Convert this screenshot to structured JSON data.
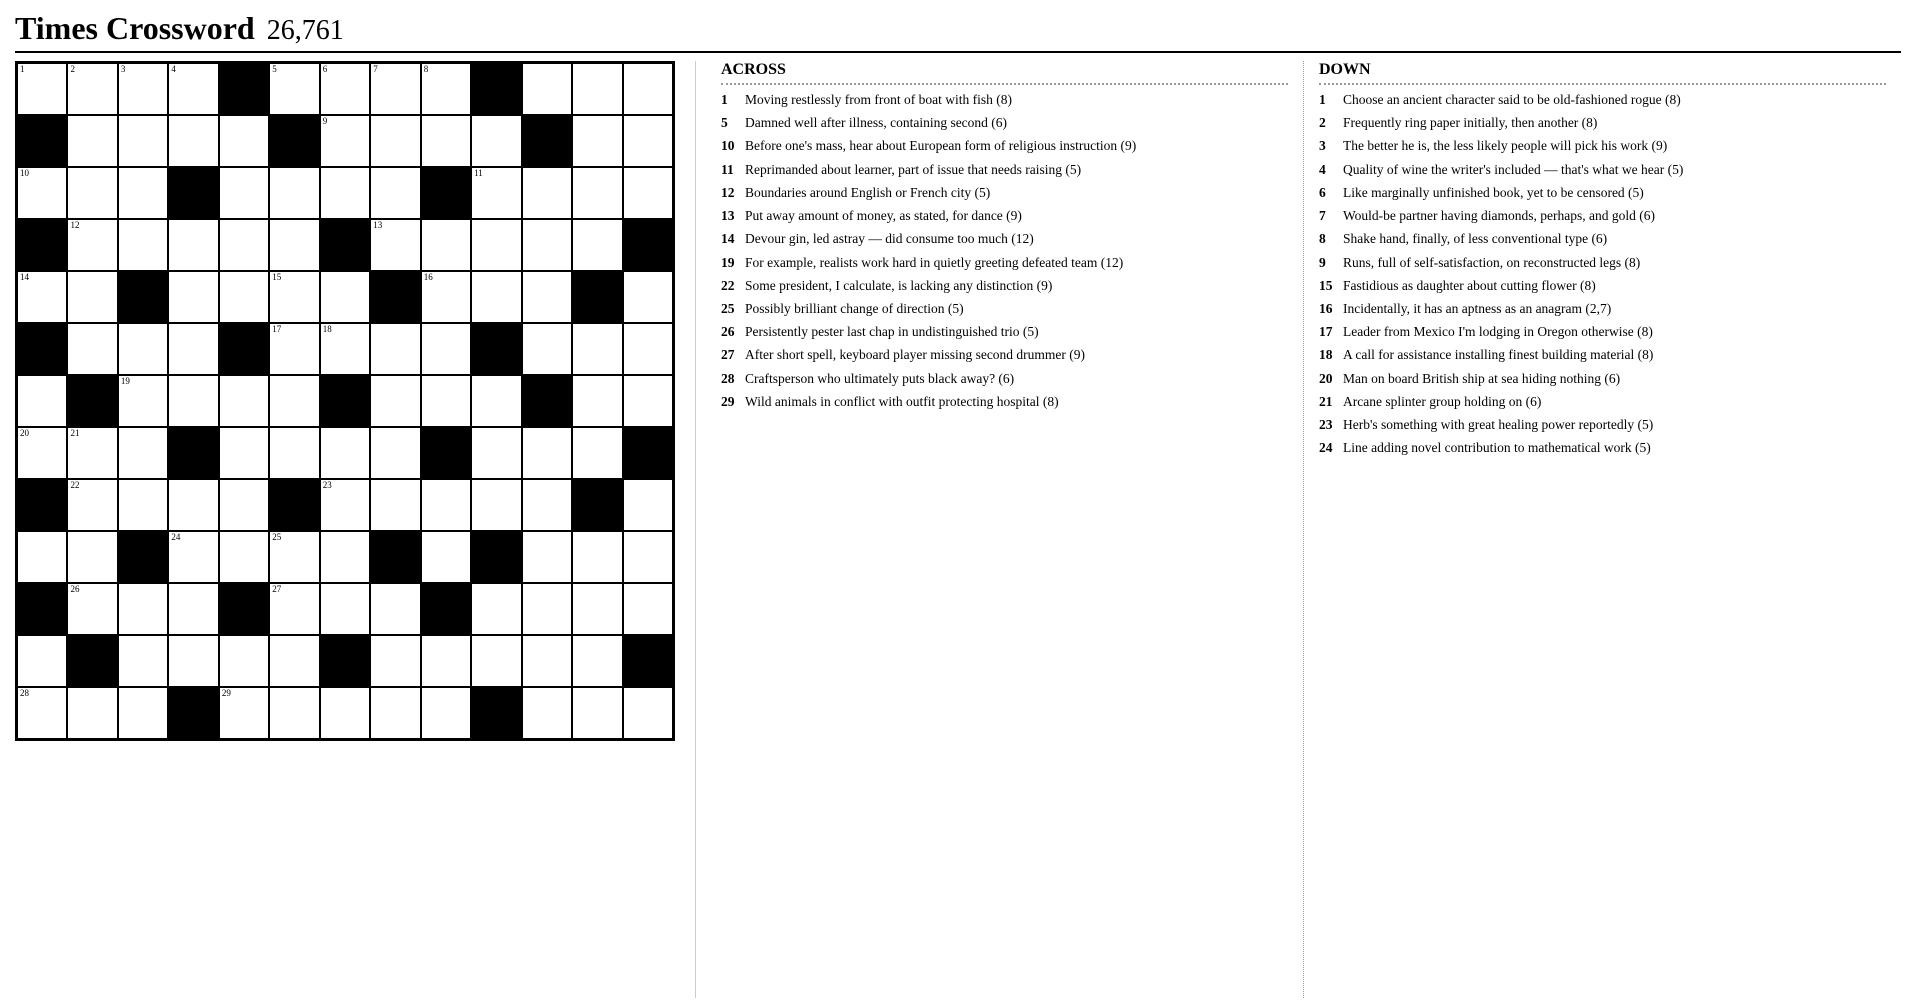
{
  "header": {
    "title": "Times Crossword",
    "number": "26,761"
  },
  "grid": {
    "size": 13,
    "black_cells": [
      [
        0,
        4
      ],
      [
        0,
        9
      ],
      [
        1,
        0
      ],
      [
        1,
        5
      ],
      [
        1,
        10
      ],
      [
        2,
        3
      ],
      [
        2,
        8
      ],
      [
        3,
        0
      ],
      [
        3,
        6
      ],
      [
        3,
        12
      ],
      [
        4,
        2
      ],
      [
        4,
        7
      ],
      [
        4,
        11
      ],
      [
        5,
        0
      ],
      [
        5,
        4
      ],
      [
        5,
        9
      ],
      [
        6,
        1
      ],
      [
        6,
        6
      ],
      [
        6,
        10
      ],
      [
        7,
        3
      ],
      [
        7,
        8
      ],
      [
        7,
        12
      ],
      [
        8,
        0
      ],
      [
        8,
        5
      ],
      [
        8,
        11
      ],
      [
        9,
        2
      ],
      [
        9,
        7
      ],
      [
        9,
        9
      ],
      [
        10,
        0
      ],
      [
        10,
        4
      ],
      [
        10,
        8
      ],
      [
        11,
        1
      ],
      [
        11,
        6
      ],
      [
        11,
        12
      ],
      [
        12,
        3
      ],
      [
        12,
        9
      ]
    ],
    "numbered_cells": [
      {
        "row": 0,
        "col": 0,
        "num": 1
      },
      {
        "row": 0,
        "col": 1,
        "num": 2
      },
      {
        "row": 0,
        "col": 2,
        "num": 3
      },
      {
        "row": 0,
        "col": 3,
        "num": 4
      },
      {
        "row": 0,
        "col": 5,
        "num": 5
      },
      {
        "row": 0,
        "col": 6,
        "num": 6
      },
      {
        "row": 0,
        "col": 7,
        "num": 7
      },
      {
        "row": 0,
        "col": 8,
        "num": 8
      },
      {
        "row": 1,
        "col": 6,
        "num": 9
      },
      {
        "row": 2,
        "col": 0,
        "num": 10
      },
      {
        "row": 2,
        "col": 9,
        "num": 11
      },
      {
        "row": 3,
        "col": 1,
        "num": 12
      },
      {
        "row": 3,
        "col": 7,
        "num": 13
      },
      {
        "row": 4,
        "col": 0,
        "num": 14
      },
      {
        "row": 4,
        "col": 5,
        "num": 15
      },
      {
        "row": 4,
        "col": 8,
        "num": 16
      },
      {
        "row": 5,
        "col": 5,
        "num": 17
      },
      {
        "row": 5,
        "col": 6,
        "num": 18
      },
      {
        "row": 6,
        "col": 2,
        "num": 19
      },
      {
        "row": 7,
        "col": 0,
        "num": 20
      },
      {
        "row": 7,
        "col": 1,
        "num": 21
      },
      {
        "row": 8,
        "col": 1,
        "num": 22
      },
      {
        "row": 8,
        "col": 6,
        "num": 23
      },
      {
        "row": 9,
        "col": 3,
        "num": 24
      },
      {
        "row": 9,
        "col": 5,
        "num": 25
      },
      {
        "row": 10,
        "col": 1,
        "num": 26
      },
      {
        "row": 10,
        "col": 5,
        "num": 27
      },
      {
        "row": 12,
        "col": 0,
        "num": 28
      },
      {
        "row": 12,
        "col": 4,
        "num": 29
      }
    ]
  },
  "across": {
    "heading": "ACROSS",
    "clues": [
      {
        "num": "1",
        "text": "Moving restlessly from front of boat with fish (8)"
      },
      {
        "num": "5",
        "text": "Damned well after illness, containing second (6)"
      },
      {
        "num": "10",
        "text": "Before one's mass, hear about European form of religious instruction (9)"
      },
      {
        "num": "11",
        "text": "Reprimanded about learner, part of issue that needs raising (5)"
      },
      {
        "num": "12",
        "text": "Boundaries around English or French city (5)"
      },
      {
        "num": "13",
        "text": "Put away amount of money, as stated, for dance (9)"
      },
      {
        "num": "14",
        "text": "Devour gin, led astray — did consume too much (12)"
      },
      {
        "num": "19",
        "text": "For example, realists work hard in quietly greeting defeated team (12)"
      },
      {
        "num": "22",
        "text": "Some president, I calculate, is lacking any distinction (9)"
      },
      {
        "num": "25",
        "text": "Possibly brilliant change of direction (5)"
      },
      {
        "num": "26",
        "text": "Persistently pester last chap in undistinguished trio (5)"
      },
      {
        "num": "27",
        "text": "After short spell, keyboard player missing second drummer (9)"
      },
      {
        "num": "28",
        "text": "Craftsperson who ultimately puts black away? (6)"
      },
      {
        "num": "29",
        "text": "Wild animals in conflict with outfit protecting hospital (8)"
      }
    ]
  },
  "down": {
    "heading": "DOWN",
    "clues": [
      {
        "num": "1",
        "text": "Choose an ancient character said to be old-fashioned rogue (8)"
      },
      {
        "num": "2",
        "text": "Frequently ring paper initially, then another (8)"
      },
      {
        "num": "3",
        "text": "The better he is, the less likely people will pick his work (9)"
      },
      {
        "num": "4",
        "text": "Quality of wine the writer's included — that's what we hear (5)"
      },
      {
        "num": "6",
        "text": "Like marginally unfinished book, yet to be censored (5)"
      },
      {
        "num": "7",
        "text": "Would-be partner having diamonds, perhaps, and gold (6)"
      },
      {
        "num": "8",
        "text": "Shake hand, finally, of less conventional type (6)"
      },
      {
        "num": "9",
        "text": "Runs, full of self-satisfaction, on reconstructed legs (8)"
      },
      {
        "num": "15",
        "text": "Fastidious as daughter about cutting flower (8)"
      },
      {
        "num": "16",
        "text": "Incidentally, it has an aptness as an anagram (2,7)"
      },
      {
        "num": "17",
        "text": "Leader from Mexico I'm lodging in Oregon otherwise (8)"
      },
      {
        "num": "18",
        "text": "A call for assistance installing finest building material (8)"
      },
      {
        "num": "20",
        "text": "Man on board British ship at sea hiding nothing (6)"
      },
      {
        "num": "21",
        "text": "Arcane splinter group holding on (6)"
      },
      {
        "num": "23",
        "text": "Herb's something with great healing power reportedly (5)"
      },
      {
        "num": "24",
        "text": "Line adding novel contribution to mathematical work (5)"
      }
    ]
  }
}
